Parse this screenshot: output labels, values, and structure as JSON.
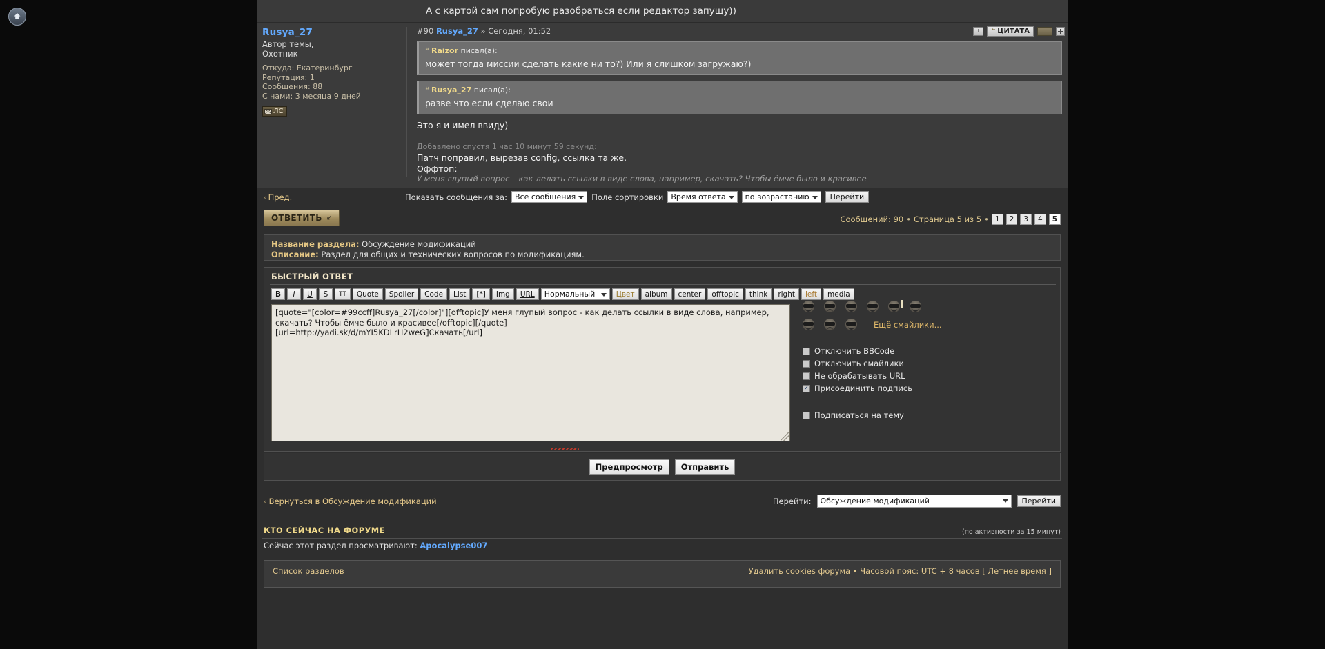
{
  "top_snippet": "А с картой сам попробую разобраться если редактор запущу))",
  "post": {
    "profile": {
      "username": "Rusya_27",
      "rank_line1": "Автор темы,",
      "rank_line2": "Охотник",
      "location": "Откуда: Екатеринбург",
      "reputation": "Репутация: 1",
      "messages": "Сообщения: 88",
      "joined": "С нами: 3 месяца 9 дней",
      "pm_button": "ЛС"
    },
    "header": {
      "number": "#90",
      "author": "Rusya_27",
      "separator": "»",
      "time": "Сегодня, 01:52",
      "quote_button": "ЦИТАТА",
      "info_icon": "i"
    },
    "quotes": [
      {
        "author": "Raizor",
        "said": "писал(а):",
        "text": "может тогда миссии сделать какие ни то?) Или я слишком загружаю?)"
      },
      {
        "author": "Rusya_27",
        "said": "писал(а):",
        "text": "разве что если сделаю свои"
      }
    ],
    "body_line": "Это я и имел ввиду)",
    "added_note": "Добавлено спустя 1 час 10 минут 59 секунд:",
    "patch_line": "Патч поправил, вырезав config, ссылка та же.",
    "offtop_label": "Оффтоп:",
    "offtop_text": "У меня глупый вопрос – как делать ссылки в виде слова, например, скачать? Чтобы ёмче было и красивее"
  },
  "navbar": {
    "prev": "Пред.",
    "show_messages_label": "Показать сообщения за:",
    "show_messages_value": "Все сообщения",
    "sort_field_label": "Поле сортировки",
    "sort_field_value": "Время ответа",
    "sort_order_value": "по возрастанию",
    "go_button": "Перейти"
  },
  "reply": {
    "button_label": "ОТВЕТИТЬ",
    "pagination": {
      "messages": "Сообщений: 90",
      "page": "Страница 5 из 5",
      "pages": [
        "1",
        "2",
        "3",
        "4",
        "5"
      ],
      "active_page": "5"
    }
  },
  "infobox": {
    "section_label": "Название раздела:",
    "section_value": "Обсуждение модификаций",
    "desc_label": "Описание:",
    "desc_value": "Раздел для общих и технических вопросов по модификациям."
  },
  "quick_reply": {
    "title": "БЫСТРЫЙ ОТВЕТ",
    "bbcode_buttons": [
      "B",
      "I",
      "U",
      "S",
      "TT",
      "Quote",
      "Spoiler",
      "Code",
      "List",
      "[*]",
      "Img",
      "URL"
    ],
    "font_size_value": "Нормальный",
    "extra_buttons": [
      "Цвет",
      "album",
      "center",
      "offtopic",
      "think",
      "right",
      "left",
      "media"
    ],
    "textarea_value": "[quote=\"[color=#99ccff]Rusya_27[/color]\"][offtopic]У меня глупый вопрос - как делать ссылки в виде слова, например, скачать? Чтобы ёмче было и красивее[/offtopic][/quote]\n[url=http://yadi.sk/d/mYI5KDLrH2weG]Скачать[/url]",
    "more_smilies": "Ещё смайлики...",
    "options": [
      {
        "label": "Отключить BBCode",
        "checked": false
      },
      {
        "label": "Отключить смайлики",
        "checked": false
      },
      {
        "label": "Не обрабатывать URL",
        "checked": false
      },
      {
        "label": "Присоединить подпись",
        "checked": true
      }
    ],
    "subscribe": {
      "label": "Подписаться на тему",
      "checked": false
    },
    "preview_button": "Предпросмотр",
    "submit_button": "Отправить"
  },
  "return_row": {
    "back_link": "Вернуться в Обсуждение модификаций",
    "jump_label": "Перейти:",
    "jump_value": "Обсуждение модификаций",
    "jump_button": "Перейти"
  },
  "online": {
    "heading": "КТО СЕЙЧАС НА ФОРУМЕ",
    "activity_note": "(по активности за 15 минут)",
    "viewing_label": "Сейчас этот раздел просматривают:",
    "viewing_user": "Apocalypse007"
  },
  "footer": {
    "board_index": "Список разделов",
    "right_text": "Удалить cookies форума • Часовой пояс: UTC + 8 часов [ Летнее время ]"
  },
  "colors": {
    "accent_gold": "#e6c98a",
    "link_blue": "#63aaff",
    "quote_author": "#f0d98a",
    "bg_dark": "#2e2e2e"
  }
}
